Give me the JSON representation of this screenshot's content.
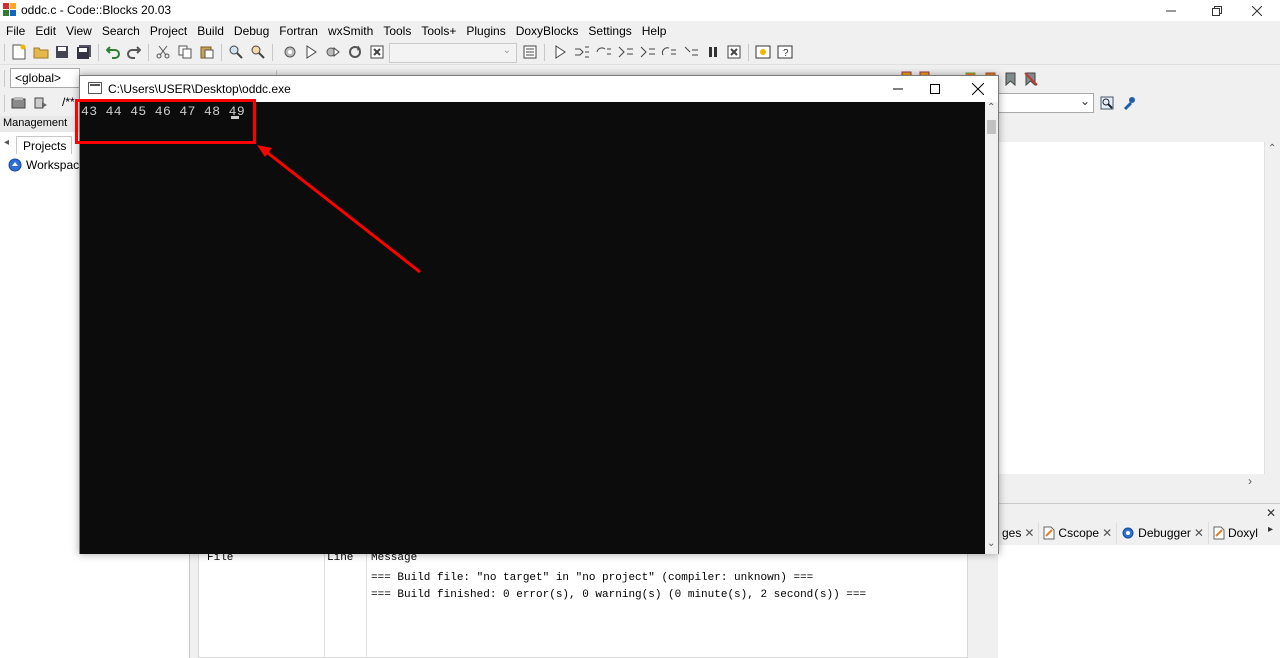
{
  "window": {
    "title": "oddc.c - Code::Blocks 20.03"
  },
  "menubar": {
    "items": [
      "File",
      "Edit",
      "View",
      "Search",
      "Project",
      "Build",
      "Debug",
      "Fortran",
      "wxSmith",
      "Tools",
      "Tools+",
      "Plugins",
      "DoxyBlocks",
      "Settings",
      "Help"
    ]
  },
  "toolbar2": {
    "scope_combo": "<global>",
    "comment_prefix": "/**"
  },
  "management": {
    "header": "Management",
    "tab": "Projects",
    "workspace": "Workspace"
  },
  "console": {
    "title": "C:\\Users\\USER\\Desktop\\oddc.exe",
    "output": "43 44 45 46 47 48 49"
  },
  "logs": {
    "tabs": [
      "ges",
      "Cscope",
      "Debugger",
      "Doxyl"
    ],
    "columns": [
      "File",
      "Line",
      "Message"
    ],
    "messages": [
      "=== Build file: \"no target\" in \"no project\" (compiler: unknown) ===",
      "=== Build finished: 0 error(s), 0 warning(s) (0 minute(s), 2 second(s)) ==="
    ]
  },
  "colors": {
    "console_bg": "#0c0c0c",
    "console_text": "#cccccc",
    "annotation": "#ff0000"
  }
}
